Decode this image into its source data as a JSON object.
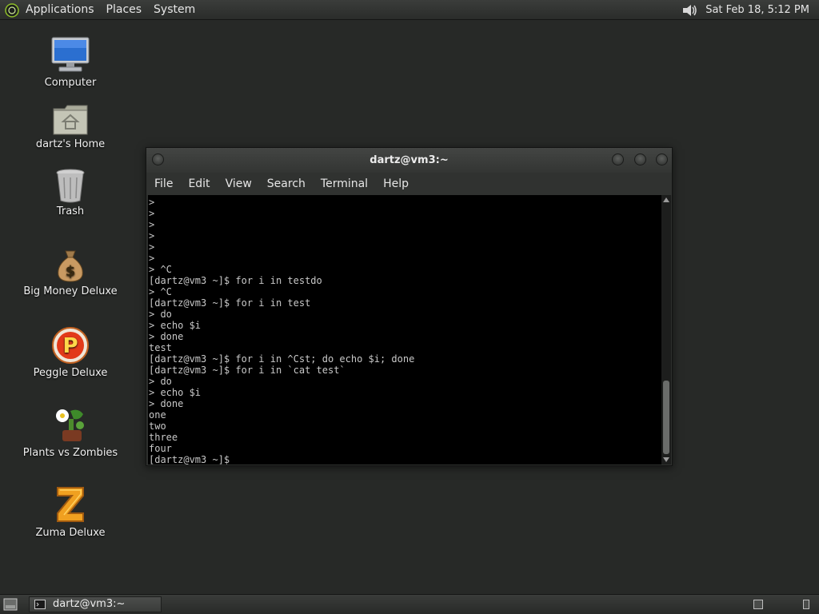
{
  "top_panel": {
    "menus": [
      "Applications",
      "Places",
      "System"
    ],
    "clock": "Sat Feb 18,  5:12 PM",
    "icons": {
      "logo": "gnome-foot-icon",
      "volume": "speaker-icon"
    }
  },
  "desktop_icons": [
    {
      "label": "Computer",
      "icon": "computer-icon"
    },
    {
      "label": "dartz's Home",
      "icon": "home-folder-icon"
    },
    {
      "label": "Trash",
      "icon": "trash-icon"
    },
    {
      "label": "Big Money Deluxe",
      "icon": "money-bag-icon"
    },
    {
      "label": "Peggle Deluxe",
      "icon": "peggle-icon"
    },
    {
      "label": "Plants vs Zombies",
      "icon": "plants-vs-zombies-icon"
    },
    {
      "label": "Zuma Deluxe",
      "icon": "zuma-icon"
    }
  ],
  "terminal": {
    "title": "dartz@vm3:~",
    "menu": [
      "File",
      "Edit",
      "View",
      "Search",
      "Terminal",
      "Help"
    ],
    "lines": [
      ">",
      ">",
      ">",
      ">",
      ">",
      ">",
      "> ^C",
      "[dartz@vm3 ~]$ for i in testdo",
      "> ^C",
      "[dartz@vm3 ~]$ for i in test",
      "> do",
      "> echo $i",
      "> done",
      "test",
      "[dartz@vm3 ~]$ for i in ^Cst; do echo $i; done",
      "[dartz@vm3 ~]$ for i in `cat test`",
      "> do",
      "> echo $i",
      "> done",
      "one",
      "two",
      "three",
      "four",
      "[dartz@vm3 ~]$ "
    ]
  },
  "taskbar": {
    "task_label": "dartz@vm3:~"
  },
  "colors": {
    "desktop_bg": "#272927",
    "terminal_bg": "#000000",
    "terminal_fg": "#c8c8c8"
  }
}
